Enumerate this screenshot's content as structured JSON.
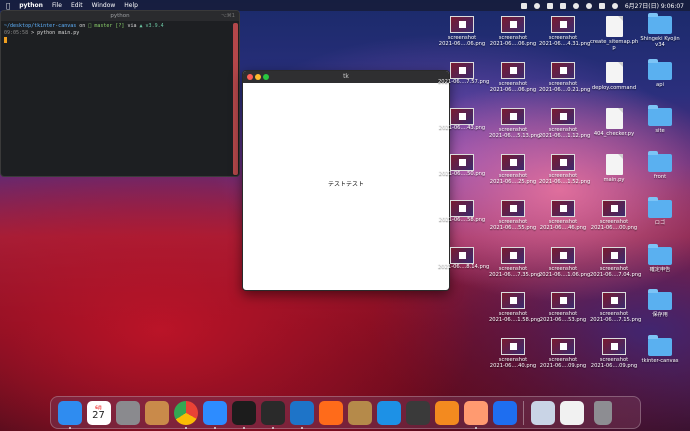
{
  "menubar": {
    "app": "python",
    "menus": [
      "File",
      "Edit",
      "Window",
      "Help"
    ],
    "clock": "6月27日(日)  9:06:07"
  },
  "terminal": {
    "title": "python",
    "shortcut": "⌥⌘1",
    "line1_path": "~/desktop/tkinter-canvas",
    "line1_on": "on",
    "line1_branch": "master [?]",
    "line1_via": "via",
    "line1_version": "v3.9.4",
    "line2_time": "09:05:58",
    "line2_cmd": "> python main.py"
  },
  "tk_window": {
    "title": "tk",
    "label": "テストテスト"
  },
  "desktop_icons": [
    {
      "kind": "thumb",
      "l1": "screenshot",
      "l2": "2021-06....06.png"
    },
    {
      "kind": "thumb",
      "l1": "screenshot",
      "l2": "2021-06....06.png"
    },
    {
      "kind": "thumb",
      "l1": "screenshot",
      "l2": "2021-06....4.31.png"
    },
    {
      "kind": "doc",
      "l1": "create_sitemap.ph",
      "l2": "p"
    },
    {
      "kind": "folder",
      "l1": "Shingeki Kyojin",
      "l2": "v34"
    },
    {
      "kind": "thumb",
      "l1": "",
      "l2": "2021-06....7.57.png"
    },
    {
      "kind": "thumb",
      "l1": "screenshot",
      "l2": "2021-06....06.png"
    },
    {
      "kind": "thumb",
      "l1": "screenshot",
      "l2": "2021-06....0.21.png"
    },
    {
      "kind": "doc",
      "l1": "deploy.command",
      "l2": ""
    },
    {
      "kind": "folder",
      "l1": "api",
      "l2": ""
    },
    {
      "kind": "thumb",
      "l1": "",
      "l2": "2021-06....43.png"
    },
    {
      "kind": "thumb",
      "l1": "screenshot",
      "l2": "2021-06....5.13.png"
    },
    {
      "kind": "thumb",
      "l1": "screenshot",
      "l2": "2021-06....1.12.png"
    },
    {
      "kind": "doc",
      "l1": "404_checker.py",
      "l2": ""
    },
    {
      "kind": "folder",
      "l1": "site",
      "l2": ""
    },
    {
      "kind": "thumb",
      "l1": "",
      "l2": "2021-06....50.png"
    },
    {
      "kind": "thumb",
      "l1": "screenshot",
      "l2": "2021-06....25.png"
    },
    {
      "kind": "thumb",
      "l1": "screenshot",
      "l2": "2021-06....1.52.png"
    },
    {
      "kind": "doc",
      "l1": "main.py",
      "l2": ""
    },
    {
      "kind": "folder",
      "l1": "front",
      "l2": ""
    },
    {
      "kind": "thumb",
      "l1": "",
      "l2": "2021-06....58.png"
    },
    {
      "kind": "thumb",
      "l1": "screenshot",
      "l2": "2021-06....55.png"
    },
    {
      "kind": "thumb",
      "l1": "screenshot",
      "l2": "2021-06....46.png"
    },
    {
      "kind": "thumb",
      "l1": "screenshot",
      "l2": "2021-06....00.png"
    },
    {
      "kind": "folder",
      "l1": "ロゴ",
      "l2": ""
    },
    {
      "kind": "thumb",
      "l1": "",
      "l2": "2021-06....8.14.png"
    },
    {
      "kind": "thumb",
      "l1": "screenshot",
      "l2": "2021-06....7.35.png"
    },
    {
      "kind": "thumb",
      "l1": "screenshot",
      "l2": "2021-06....1.06.png"
    },
    {
      "kind": "thumb",
      "l1": "screenshot",
      "l2": "2021-06....7.04.png"
    },
    {
      "kind": "folder",
      "l1": "確定申告",
      "l2": ""
    },
    {
      "kind": "thumb",
      "l1": "screenshot",
      "l2": "2021-06....1.58.png"
    },
    {
      "kind": "thumb",
      "l1": "screenshot",
      "l2": "2021-06....53.png"
    },
    {
      "kind": "thumb",
      "l1": "screenshot",
      "l2": "2021-06....7.15.png"
    },
    {
      "kind": "folder",
      "l1": "保存用",
      "l2": ""
    },
    {
      "kind": "thumb",
      "l1": "screenshot",
      "l2": "2021-06....40.png"
    },
    {
      "kind": "thumb",
      "l1": "screenshot",
      "l2": "2021-06....09.png"
    },
    {
      "kind": "thumb",
      "l1": "screenshot",
      "l2": "2021-06....09.png"
    },
    {
      "kind": "folder",
      "l1": "tkinter-canvas",
      "l2": ""
    }
  ],
  "dock": {
    "calendar_month": "6月",
    "calendar_day": "27",
    "apps": [
      {
        "name": "finder",
        "color": "#2f8cf0"
      },
      {
        "name": "calendar",
        "color": "#ffffff"
      },
      {
        "name": "system-preferences",
        "color": "#8a8a8e"
      },
      {
        "name": "contacts",
        "color": "#c98a4a"
      },
      {
        "name": "chrome",
        "color": "#ffffff"
      },
      {
        "name": "zoom",
        "color": "#2d8cff"
      },
      {
        "name": "activity-monitor",
        "color": "#1c1c1c"
      },
      {
        "name": "terminal",
        "color": "#2a2a2a"
      },
      {
        "name": "vscode",
        "color": "#1e74c8"
      },
      {
        "name": "stocks",
        "color": "#ff6b1a"
      },
      {
        "name": "unarchiver",
        "color": "#b58a4a"
      },
      {
        "name": "docker",
        "color": "#1d91e6"
      },
      {
        "name": "quicktime",
        "color": "#3a3a3a"
      },
      {
        "name": "sourcetree",
        "color": "#f38a1f"
      },
      {
        "name": "notes-app",
        "color": "#ff9a70"
      },
      {
        "name": "infinity",
        "color": "#1e6ef0"
      }
    ],
    "trailing": [
      "preview-stack",
      "document-stack",
      "trash"
    ]
  }
}
